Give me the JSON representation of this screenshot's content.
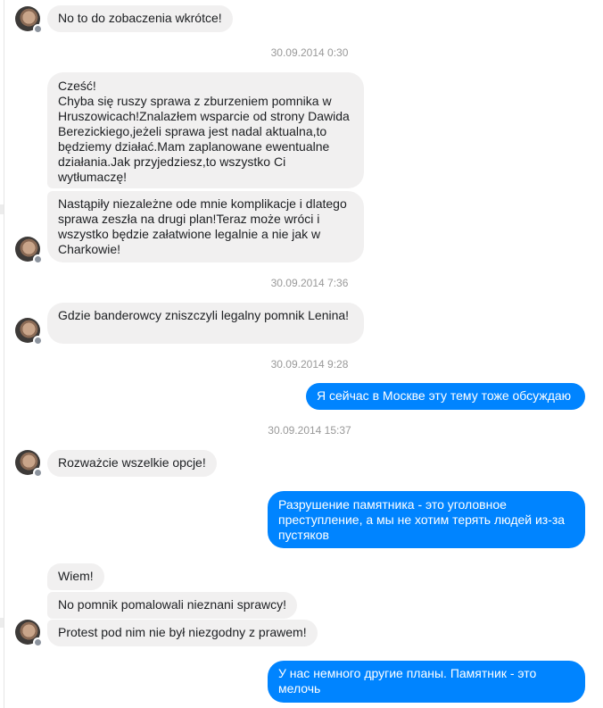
{
  "messages": [
    {
      "kind": "incoming",
      "text": "No to do zobaczenia wkrótce!"
    },
    {
      "kind": "timestamp",
      "text": "30.09.2014 0:30"
    },
    {
      "kind": "incoming",
      "text": "Cześć!\nChyba się ruszy sprawa z zburzeniem pomnika w Hruszowicach!Znalazłem wsparcie od strony Dawida Berezickiego,jeżeli sprawa jest nadal aktualna,to będziemy działać.Mam zaplanowane ewentualne działania.Jak przyjedziesz,to wszystko Ci wytłumaczę!"
    },
    {
      "kind": "incoming",
      "text": "Nastąpiły niezależne ode mnie komplikacje i dlatego sprawa zeszła na drugi plan!Teraz może wróci i wszystko będzie załatwione legalnie a nie jak w Charkowie!"
    },
    {
      "kind": "timestamp",
      "text": "30.09.2014 7:36"
    },
    {
      "kind": "incoming",
      "text": "Gdzie banderowcy zniszczyli legalny pomnik Lenina!"
    },
    {
      "kind": "timestamp",
      "text": "30.09.2014 9:28"
    },
    {
      "kind": "outgoing",
      "text": "Я сейчас в Москве эту тему тоже обсуждаю"
    },
    {
      "kind": "timestamp",
      "text": "30.09.2014 15:37"
    },
    {
      "kind": "incoming",
      "text": "Rozważcie wszelkie opcje!"
    },
    {
      "kind": "outgoing",
      "text": "Разрушение памятника - это уголовное преступление, а мы не хотим терять людей из-за пустяков"
    },
    {
      "kind": "incoming",
      "text": "Wiem!"
    },
    {
      "kind": "incoming",
      "text": "No pomnik pomalowali nieznani sprawcy!"
    },
    {
      "kind": "incoming",
      "text": "Protest pod nim nie był niezgodny z prawem!"
    },
    {
      "kind": "outgoing",
      "text": "У нас немного другие планы. Памятник - это мелочь"
    }
  ],
  "colors": {
    "incoming_bubble": "#f1f0f0",
    "outgoing_bubble": "#0084ff",
    "timestamp_text": "#999999"
  },
  "icons": {
    "avatar": "contact-avatar",
    "badge": "messenger-badge-icon"
  }
}
